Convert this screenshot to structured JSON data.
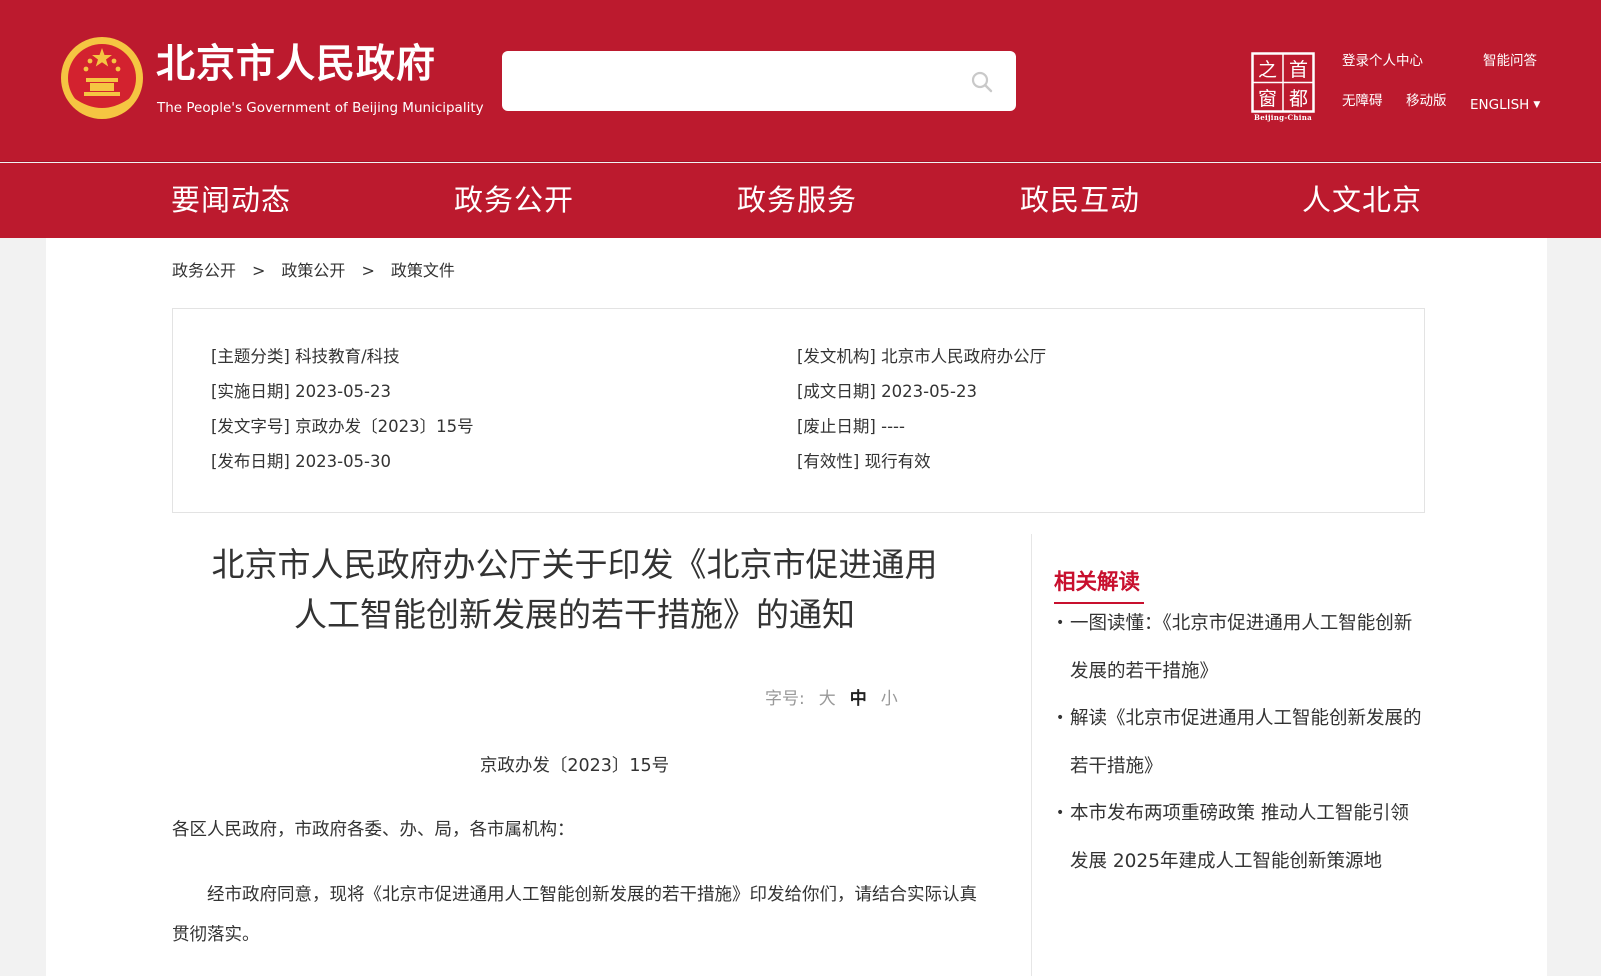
{
  "header": {
    "title": "北京市人民政府",
    "subtitle": "The People's Government of Beijing Municipality",
    "search": {
      "placeholder": "",
      "value": ""
    },
    "seal": {
      "chars": [
        "之",
        "首",
        "窗",
        "都"
      ],
      "caption": "Beijing-China"
    },
    "links": {
      "login": "登录个人中心",
      "qa": "智能问答",
      "accessibility": "无障碍",
      "mobile": "移动版",
      "english": "ENGLISH"
    }
  },
  "nav": {
    "items": [
      "要闻动态",
      "政务公开",
      "政务服务",
      "政民互动",
      "人文北京"
    ]
  },
  "breadcrumb": [
    "政务公开",
    "政策公开",
    "政策文件"
  ],
  "meta": {
    "topic": "[主题分类] 科技教育/科技",
    "issuer": "[发文机构] 北京市人民政府办公厅",
    "effective_date": "[实施日期] 2023-05-23",
    "written_date": "[成文日期] 2023-05-23",
    "doc_no": "[发文字号] 京政办发〔2023〕15号",
    "abolish_date": "[废止日期] ----",
    "publish_date": "[发布日期] 2023-05-30",
    "validity": "[有效性] 现行有效"
  },
  "article": {
    "title_line1": "北京市人民政府办公厅关于印发《北京市促进通用",
    "title_line2": "人工智能创新发展的若干措施》的通知",
    "font_size_label": "字号:",
    "font_large": "大",
    "font_medium": "中",
    "font_small": "小",
    "doc_number": "京政办发〔2023〕15号",
    "recipient": "各区人民政府，市政府各委、办、局，各市属机构：",
    "paragraph": "经市政府同意，现将《北京市促进通用人工智能创新发展的若干措施》印发给你们，请结合实际认真贯彻落实。"
  },
  "related": {
    "title": "相关解读",
    "items": [
      "一图读懂：《北京市促进通用人工智能创新发展的若干措施》",
      "解读《北京市促进通用人工智能创新发展的若干措施》",
      "本市发布两项重磅政策 推动人工智能引领发展 2025年建成人工智能创新策源地"
    ]
  },
  "colors": {
    "brand_red": "#bc1a2e",
    "accent_red": "#c8102e",
    "emblem_gold": "#f5c542"
  }
}
